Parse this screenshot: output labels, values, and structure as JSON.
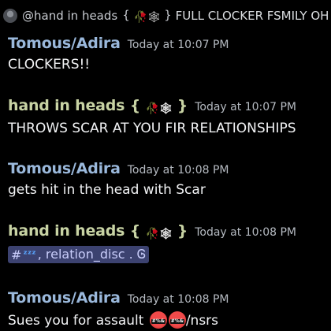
{
  "reply": {
    "author": "@hand in heads",
    "text": "FULL CLOCKER FSMILY OH M"
  },
  "messages": [
    {
      "author": "Tomous/Adira",
      "author_color": "#9ab8db",
      "timestamp": "Today at 10:07 PM",
      "content": "CLOCKERS!!"
    },
    {
      "author": "hand in heads",
      "author_color": "#c8d3a4",
      "timestamp": "Today at 10:07 PM",
      "content": "THROWS SCAR AT YOU FIR RELATIONSHIPS"
    },
    {
      "author": "Tomous/Adira",
      "author_color": "#9ab8db",
      "timestamp": "Today at 10:08 PM",
      "content": "gets hit in the head with Scar"
    },
    {
      "author": "hand in heads",
      "author_color": "#c8d3a4",
      "timestamp": "Today at 10:08 PM",
      "channel_mention": {
        "hash": "#",
        "text": ", relation_disc . Ꮆ"
      }
    },
    {
      "author": "Tomous/Adira",
      "author_color": "#9ab8db",
      "timestamp": "Today at 10:08 PM",
      "content_prefix": "Sues you for assault",
      "content_suffix": "/nsrs"
    }
  ],
  "icons": {
    "rose": "wilted-rose-icon",
    "web": "spider-web-icon",
    "zzz": "zzz-icon",
    "angry": "angry-face-icon"
  }
}
